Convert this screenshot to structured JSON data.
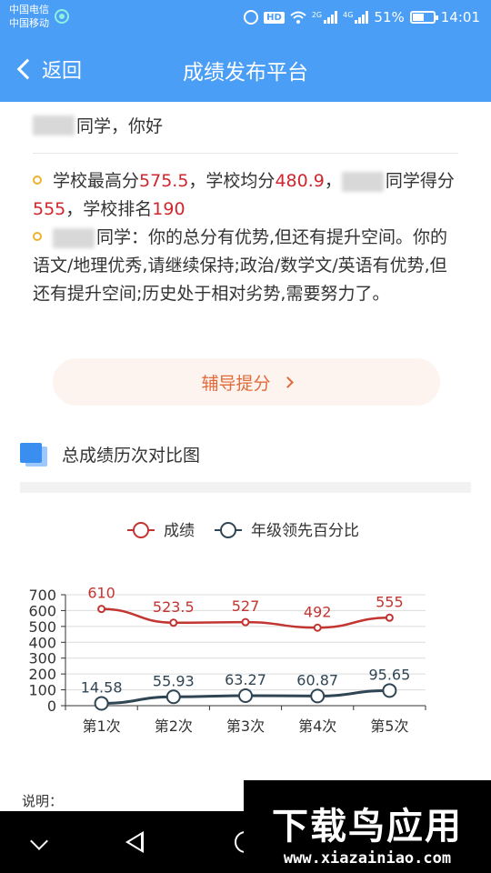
{
  "status": {
    "carrier1": "中国电信",
    "carrier2": "中国移动",
    "hd": "HD",
    "net1": "2G",
    "net2": "4G",
    "battery": "51%",
    "time": "14:01"
  },
  "header": {
    "back_label": "返回",
    "title": "成绩发布平台"
  },
  "greeting": {
    "text": "同学，你好"
  },
  "summary": {
    "p1_a": "学校最高分",
    "p1_max": "575.5",
    "p1_b": "，学校均分",
    "p1_avg": "480.9",
    "p1_c": "，",
    "p1_d": "同学得分",
    "p1_score": "555",
    "p1_e": "，学校排名",
    "p1_rank": "190",
    "p2": "同学：你的总分有优势,但还有提升空间。你的语文/地理优秀,请继续保持;政治/数学文/英语有优势,但还有提升空间;历史处于相对劣势,需要努力了。"
  },
  "tutor_button": {
    "label": "辅导提分"
  },
  "section": {
    "title": "总成绩历次对比图"
  },
  "chart_data": {
    "type": "line",
    "categories": [
      "第1次",
      "第2次",
      "第3次",
      "第4次",
      "第5次"
    ],
    "series": [
      {
        "name": "成绩",
        "values": [
          610,
          523.5,
          527,
          492,
          555
        ],
        "labels": [
          "610",
          "523.5",
          "527",
          "492",
          "555"
        ],
        "color": "#c23531"
      },
      {
        "name": "年级领先百分比",
        "values": [
          14.58,
          55.93,
          63.27,
          60.87,
          95.65
        ],
        "labels": [
          "14.58",
          "55.93",
          "63.27",
          "60.87",
          "95.65"
        ],
        "color": "#2f4554"
      }
    ],
    "ylim": [
      0,
      700
    ],
    "yticks": [
      0,
      100,
      200,
      300,
      400,
      500,
      600,
      700
    ],
    "ytick_labels": [
      "0",
      "100",
      "200",
      "300",
      "400",
      "500",
      "600",
      "700"
    ],
    "grid": true,
    "legend": "top-center"
  },
  "note": {
    "label": "说明："
  },
  "watermark": {
    "logo": "下载鸟应用",
    "url": "www.xiazainiao.com"
  }
}
